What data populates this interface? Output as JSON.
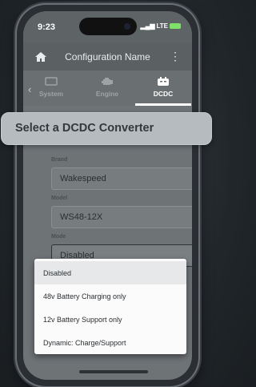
{
  "status_bar": {
    "time": "9:23",
    "network": "LTE"
  },
  "app_bar": {
    "title": "Configuration Name",
    "home_icon": "home-icon",
    "more_icon": "more-vert-icon"
  },
  "tabs": [
    {
      "label": "System",
      "icon": "monitor-icon"
    },
    {
      "label": "Engine",
      "icon": "engine-icon"
    },
    {
      "label": "DCDC",
      "icon": "battery-converter-icon",
      "active": true
    }
  ],
  "modal": {
    "title": "Select a DCDC Converter"
  },
  "form": {
    "brand": {
      "label": "Brand",
      "value": "Wakespeed"
    },
    "model": {
      "label": "Model",
      "value": "WS48-12X"
    },
    "mode": {
      "label": "Mode",
      "value": "Disabled"
    }
  },
  "dropdown": {
    "options": [
      "Disabled",
      "48v Battery Charging only",
      "12v Battery Support only",
      "Dynamic: Charge/Support"
    ],
    "selected": "Disabled"
  },
  "colors": {
    "battery": "#7ee26a",
    "modal_bg": "#b5bbbe"
  }
}
